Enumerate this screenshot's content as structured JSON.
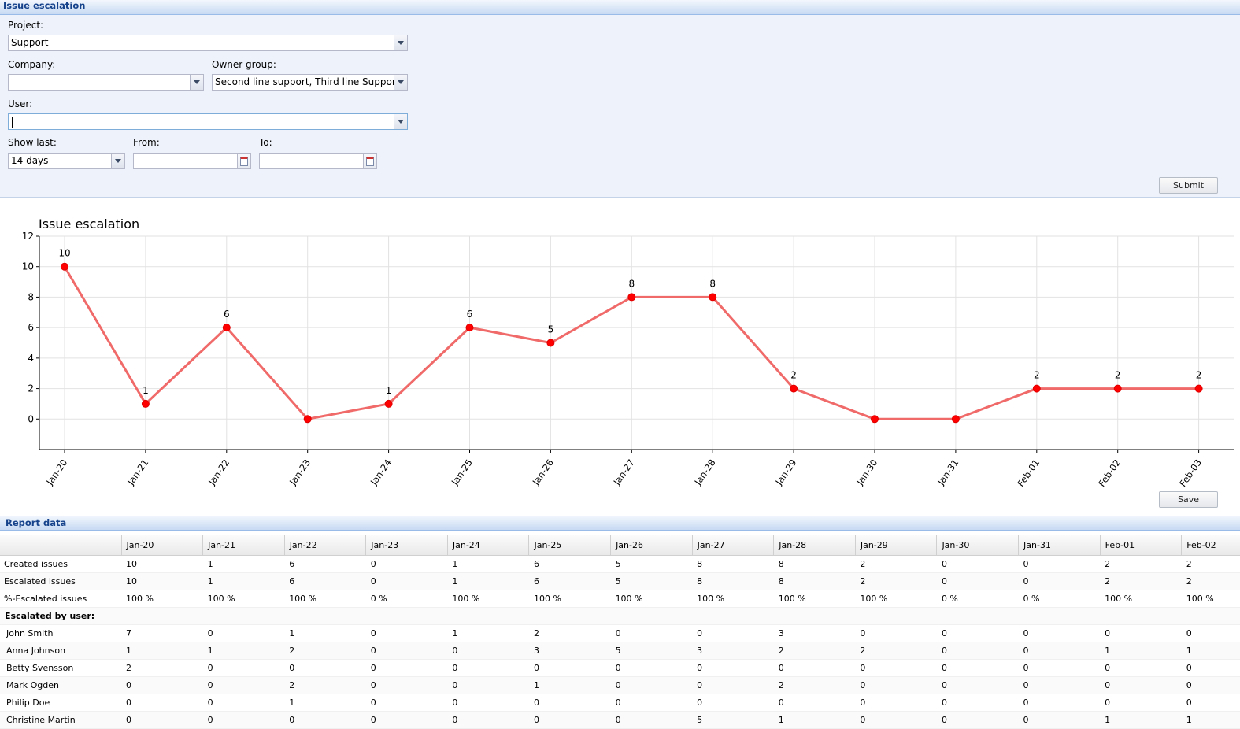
{
  "panel_title": "Issue escalation",
  "filters": {
    "project_label": "Project:",
    "project_value": "Support",
    "company_label": "Company:",
    "company_value": "",
    "owner_group_label": "Owner group:",
    "owner_group_value": "Second line support, Third line Support",
    "user_label": "User:",
    "user_value": "",
    "show_last_label": "Show last:",
    "show_last_value": "14 days",
    "from_label": "From:",
    "from_value": "",
    "to_label": "To:",
    "to_value": "",
    "submit_label": "Submit"
  },
  "chart_data": {
    "type": "line",
    "title": "Issue escalation",
    "categories": [
      "Jan-20",
      "Jan-21",
      "Jan-22",
      "Jan-23",
      "Jan-24",
      "Jan-25",
      "Jan-26",
      "Jan-27",
      "Jan-28",
      "Jan-29",
      "Jan-30",
      "Jan-31",
      "Feb-01",
      "Feb-02",
      "Feb-03"
    ],
    "values": [
      10,
      1,
      6,
      0,
      1,
      6,
      5,
      8,
      8,
      2,
      0,
      0,
      2,
      2,
      2
    ],
    "data_labels": [
      "10",
      "1",
      "6",
      "",
      "1",
      "6",
      "5",
      "8",
      "8",
      "2",
      "",
      "",
      "2",
      "2",
      "2"
    ],
    "y_ticks": [
      "12",
      "10",
      "8",
      "6",
      "4",
      "2",
      "0"
    ],
    "ylim": [
      -2,
      12
    ],
    "grid": true,
    "color": "#f06a6a",
    "marker_color": "#ff0000"
  },
  "save_label": "Save",
  "report": {
    "title": "Report data",
    "columns": [
      "",
      "Jan-20",
      "Jan-21",
      "Jan-22",
      "Jan-23",
      "Jan-24",
      "Jan-25",
      "Jan-26",
      "Jan-27",
      "Jan-28",
      "Jan-29",
      "Jan-30",
      "Jan-31",
      "Feb-01",
      "Feb-02"
    ],
    "rows": [
      {
        "label": "Created issues",
        "kind": "rowlabel",
        "cells": [
          "10",
          "1",
          "6",
          "0",
          "1",
          "6",
          "5",
          "8",
          "8",
          "2",
          "0",
          "0",
          "2",
          "2"
        ]
      },
      {
        "label": "Escalated issues",
        "kind": "rowlabel",
        "cells": [
          "10",
          "1",
          "6",
          "0",
          "1",
          "6",
          "5",
          "8",
          "8",
          "2",
          "0",
          "0",
          "2",
          "2"
        ]
      },
      {
        "label": "%-Escalated issues",
        "kind": "rowlabel",
        "cells": [
          "100 %",
          "100 %",
          "100 %",
          "0 %",
          "100 %",
          "100 %",
          "100 %",
          "100 %",
          "100 %",
          "100 %",
          "0 %",
          "0 %",
          "100 %",
          "100 %"
        ]
      },
      {
        "label": "Escalated by user:",
        "kind": "section",
        "cells": [
          "",
          "",
          "",
          "",
          "",
          "",
          "",
          "",
          "",
          "",
          "",
          "",
          "",
          ""
        ]
      },
      {
        "label": "John Smith",
        "kind": "user",
        "cells": [
          "7",
          "0",
          "1",
          "0",
          "1",
          "2",
          "0",
          "0",
          "3",
          "0",
          "0",
          "0",
          "0",
          "0"
        ]
      },
      {
        "label": "Anna Johnson",
        "kind": "user",
        "cells": [
          "1",
          "1",
          "2",
          "0",
          "0",
          "3",
          "5",
          "3",
          "2",
          "2",
          "0",
          "0",
          "1",
          "1"
        ]
      },
      {
        "label": "Betty Svensson",
        "kind": "user",
        "cells": [
          "2",
          "0",
          "0",
          "0",
          "0",
          "0",
          "0",
          "0",
          "0",
          "0",
          "0",
          "0",
          "0",
          "0"
        ]
      },
      {
        "label": "Mark Ogden",
        "kind": "user",
        "cells": [
          "0",
          "0",
          "2",
          "0",
          "0",
          "1",
          "0",
          "0",
          "2",
          "0",
          "0",
          "0",
          "0",
          "0"
        ]
      },
      {
        "label": "Philip Doe",
        "kind": "user",
        "cells": [
          "0",
          "0",
          "1",
          "0",
          "0",
          "0",
          "0",
          "0",
          "0",
          "0",
          "0",
          "0",
          "0",
          "0"
        ]
      },
      {
        "label": "Christine Martin",
        "kind": "user",
        "cells": [
          "0",
          "0",
          "0",
          "0",
          "0",
          "0",
          "0",
          "5",
          "1",
          "0",
          "0",
          "0",
          "1",
          "1"
        ]
      }
    ]
  }
}
